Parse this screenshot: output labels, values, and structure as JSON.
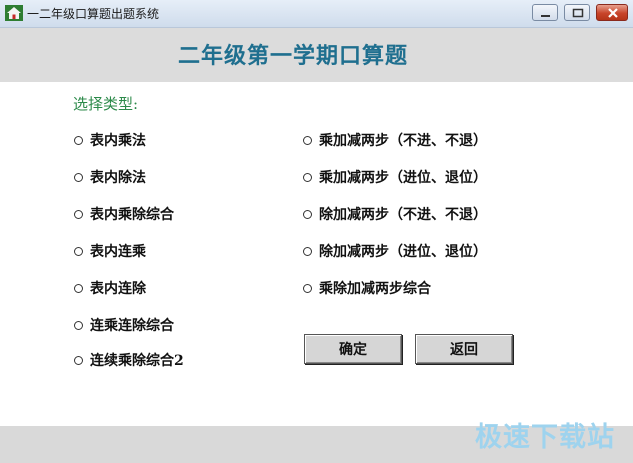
{
  "window": {
    "title": "一二年级口算题出题系统"
  },
  "header": {
    "title": "二年级第一学期口算题"
  },
  "section_label": "选择类型:",
  "options_left": [
    "表内乘法",
    "表内除法",
    "表内乘除综合",
    "表内连乘",
    "表内连除",
    "连乘连除综合",
    "连续乘除综合2"
  ],
  "options_right": [
    "乘加减两步（不进、不退）",
    "乘加减两步（进位、退位）",
    "除加减两步（不进、不退）",
    "除加减两步（进位、退位）",
    "乘除加减两步综合"
  ],
  "buttons": {
    "ok": "确定",
    "back": "返回"
  },
  "watermark": "极速下载站"
}
